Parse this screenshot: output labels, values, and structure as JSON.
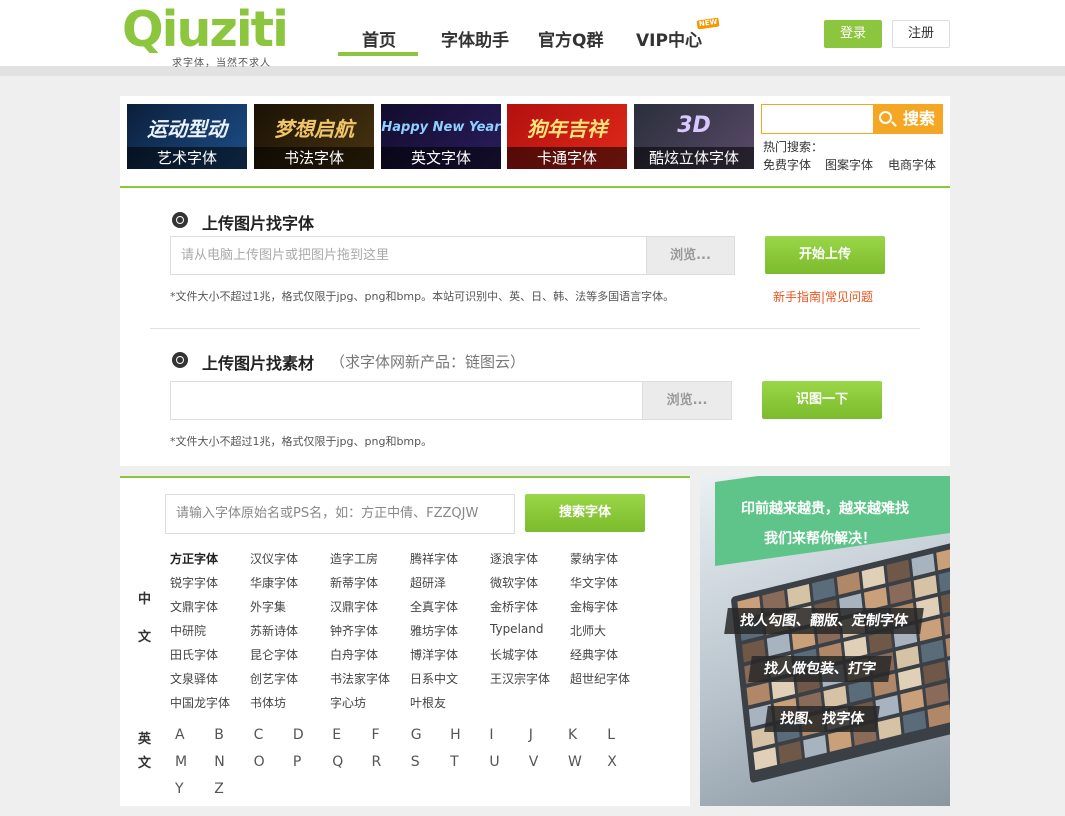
{
  "header": {
    "logo_text": "Qiuziti",
    "logo_slogan": "求字体，当然不求人",
    "nav": [
      {
        "label": "首页",
        "active": true
      },
      {
        "label": "字体助手",
        "active": false
      },
      {
        "label": "官方Q群",
        "active": false
      },
      {
        "label": "VIP中心",
        "active": false
      }
    ],
    "new_badge": "NEW",
    "login_label": "登录",
    "register_label": "注册"
  },
  "banner": {
    "categories": [
      {
        "caption": "艺术字体",
        "art": "运动型动"
      },
      {
        "caption": "书法字体",
        "art": "梦想启航"
      },
      {
        "caption": "英文字体",
        "art": "Happy New Year"
      },
      {
        "caption": "卡通字体",
        "art": "狗年吉祥"
      },
      {
        "caption": "酷炫立体字体",
        "art": "3D"
      }
    ],
    "search_button": "搜索",
    "hot_label": "热门搜索：",
    "hot_links": [
      "免费字体",
      "图案字体",
      "电商字体"
    ]
  },
  "upload": {
    "font_title": "上传图片找字体",
    "font_placeholder": "请从电脑上传图片或把图片拖到这里",
    "browse_label": "浏览...",
    "start_upload": "开始上传",
    "font_note": "*文件大小不超过1兆，格式仅限于jpg、png和bmp。本站可识别中、英、日、韩、法等多国语言字体。",
    "help_text": "新手指南|常见问题",
    "material_title": "上传图片找素材",
    "material_sub": "（求字体网新产品：链图云）",
    "material_placeholder": "",
    "identify_label": "识图一下",
    "material_note": "*文件大小不超过1兆，格式仅限于jpg、png和bmp。"
  },
  "font_search": {
    "placeholder": "请输入字体原始名或PS名，如：方正中倩、FZZQJW",
    "button": "搜索字体",
    "cn_label": [
      "中",
      "文"
    ],
    "en_label": [
      "英",
      "文"
    ],
    "cn_fonts": [
      [
        "方正字体",
        "汉仪字体",
        "造字工房",
        "腾祥字体",
        "逐浪字体",
        "蒙纳字体"
      ],
      [
        "锐字字体",
        "华康字体",
        "新蒂字体",
        "超研泽",
        "微软字体",
        "华文字体"
      ],
      [
        "文鼎字体",
        "外字集",
        "汉鼎字体",
        "全真字体",
        "金桥字体",
        "金梅字体"
      ],
      [
        "中研院",
        "苏新诗体",
        "钟齐字体",
        "雅坊字体",
        "Typeland",
        "北师大"
      ],
      [
        "田氏字体",
        "昆仑字体",
        "白舟字体",
        "博洋字体",
        "长城字体",
        "经典字体"
      ],
      [
        "文泉驿体",
        "创艺字体",
        "书法家字体",
        "日系中文",
        "王汉宗字体",
        "超世纪字体"
      ],
      [
        "中国龙字体",
        "书体坊",
        "字心坊",
        "叶根友"
      ]
    ],
    "en_letters": [
      [
        "A",
        "B",
        "C",
        "D",
        "E",
        "F",
        "G",
        "H",
        "I",
        "J",
        "K",
        "L"
      ],
      [
        "M",
        "N",
        "O",
        "P",
        "Q",
        "R",
        "S",
        "T",
        "U",
        "V",
        "W",
        "X"
      ],
      [
        "Y",
        "Z"
      ]
    ]
  },
  "ad": {
    "headline": [
      "印前越来越贵，越来越难找",
      "我们来帮你解决！"
    ],
    "pills": [
      "找人勾图、翻版、定制字体",
      "找人做包装、打字",
      "找图、找字体"
    ]
  },
  "colors": {
    "brand_green": "#8cc63f",
    "search_orange": "#f5a623",
    "help_red": "#e8541e",
    "ad_green": "#5fc48a"
  }
}
